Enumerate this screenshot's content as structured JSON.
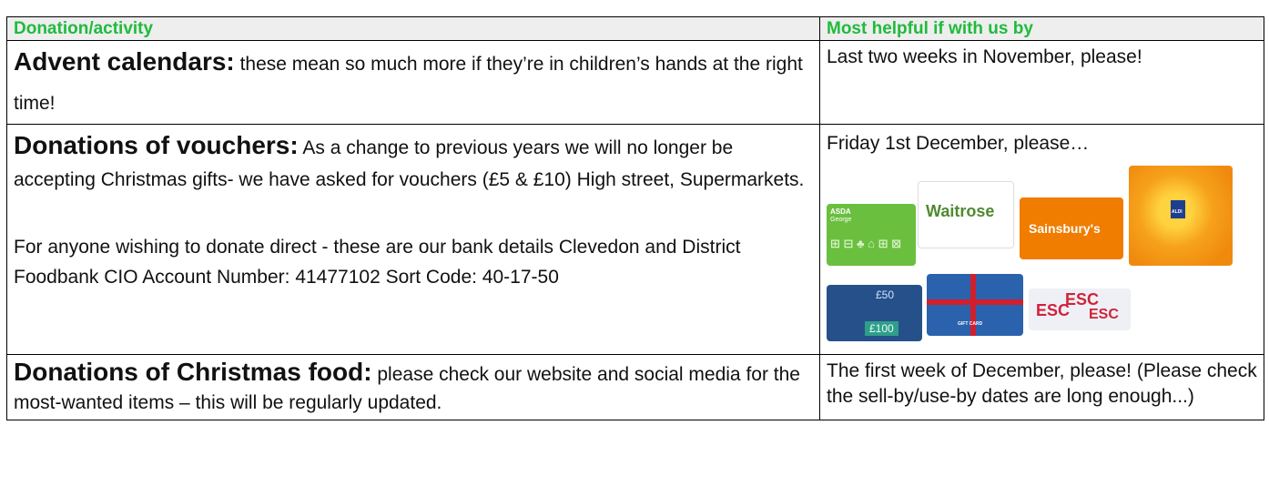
{
  "table": {
    "header": {
      "col1": "Donation/activity",
      "col2": "Most helpful if with us by"
    },
    "rows": [
      {
        "lead": "Advent calendars:",
        "text": " these mean so much more if they’re in children’s hands at the right time!",
        "when": "Last two weeks in November, please!"
      },
      {
        "lead": "Donations of vouchers:",
        "text": " As a change to previous years we will no longer be accepting Christmas gifts- we have asked for vouchers (£5 & £10) High street, Supermarkets.",
        "text2": "For anyone wishing to donate direct - these are our bank details Clevedon and District Foodbank CIO Account Number: 41477102 Sort Code: 40-17-50",
        "when": "Friday 1st December, please…",
        "cards": {
          "asda": "ASDA",
          "asda_sub": "George",
          "waitrose": "Waitrose",
          "sainsburys": "Sainsbury's",
          "aldi": "ALDI",
          "card50": "£50",
          "card100": "£100",
          "gift_card": "GIFT CARD",
          "tesco": "ESC"
        }
      },
      {
        "lead": "Donations of Christmas food:",
        "text": " please check our website and social media for the most-wanted items – this will be regularly updated.",
        "when": "The first week of December, please! (Please check the sell-by/use-by dates are long enough...)"
      }
    ]
  },
  "colors": {
    "header_text": "#1fbb3c",
    "header_bg": "#eeeeee"
  }
}
